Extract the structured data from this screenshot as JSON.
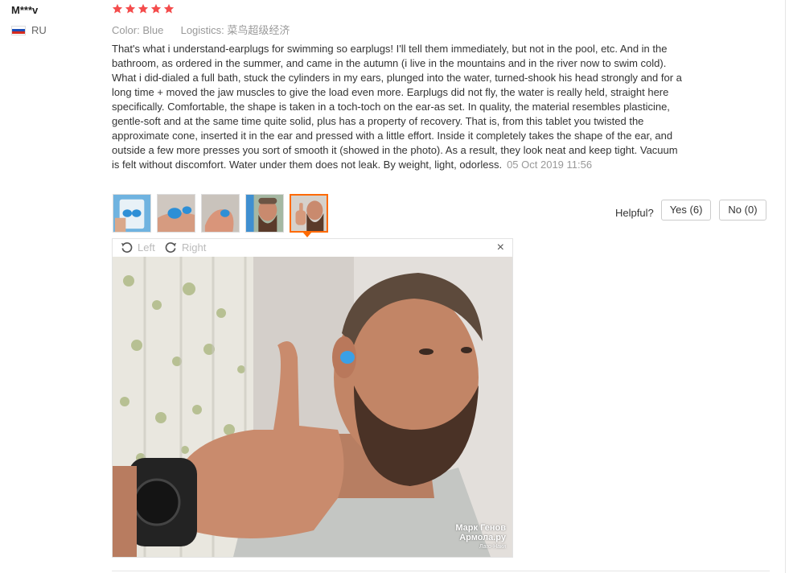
{
  "user": {
    "name": "M***v",
    "country": "RU",
    "flag_colors": [
      "#ffffff",
      "#1c4fb8",
      "#d52b1e"
    ]
  },
  "review": {
    "rating": 5,
    "star_color": "#f44c4c",
    "color_label": "Color:",
    "color_value": "Blue",
    "logistics_label": "Logistics:",
    "logistics_value": "菜鸟超级经济",
    "text": "That's what i understand-earplugs for swimming so earplugs! I'll tell them immediately, but not in the pool, etc. And in the bathroom, as ordered in the summer, and came in the autumn (i live in the mountains and in the river now to swim cold). What i did-dialed a full bath, stuck the cylinders in my ears, plunged into the water, turned-shook his head strongly and for a long time + moved the jaw muscles to give the load even more. Earplugs did not fly, the water is really held, straight here specifically. Comfortable, the shape is taken in a toch-toch on the ear-as set. In quality, the material resembles plasticine, gentle-soft and at the same time quite solid, plus has a property of recovery. That is, from this tablet you twisted the approximate cone, inserted it in the ear and pressed with a little effort. Inside it completely takes the shape of the ear, and outside a few more presses you sort of smooth it (showed in the photo). As a result, they look neat and keep tight. Vacuum is felt without discomfort. Water under them does not leak. By weight, light, odorless.",
    "date": "05 Oct 2019 11:56"
  },
  "thumbnails": [
    {
      "icon": "earplugs-package-photo",
      "active": false
    },
    {
      "icon": "earplug-in-hand-photo",
      "active": false
    },
    {
      "icon": "earplug-fingers-photo",
      "active": false
    },
    {
      "icon": "man-selfie-photo",
      "active": false
    },
    {
      "icon": "thumbs-up-selfie-photo",
      "active": true
    }
  ],
  "helpful": {
    "label": "Helpful?",
    "yes": "Yes (6)",
    "no": "No (0)"
  },
  "viewer": {
    "rotate_left": "Left",
    "rotate_right": "Right",
    "close": "×",
    "watermark_line1": "Марк Генов",
    "watermark_line2": "Армола.ру",
    "watermark_line3": "Лаго-Наки"
  },
  "colors": {
    "accent": "#ff6a00",
    "earplug": "#3aa0e6"
  }
}
